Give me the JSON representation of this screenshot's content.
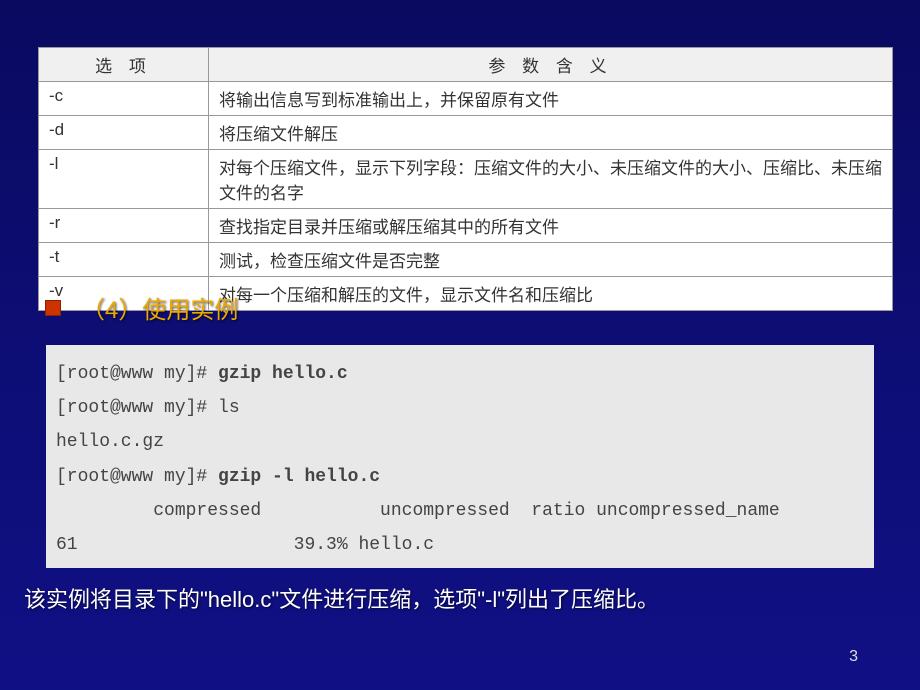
{
  "table": {
    "head_opt": "选    项",
    "head_desc": "参 数 含 义",
    "rows": [
      {
        "opt": "-c",
        "desc": "将输出信息写到标准输出上，并保留原有文件"
      },
      {
        "opt": "-d",
        "desc": "将压缩文件解压"
      },
      {
        "opt": "-l",
        "desc": "对每个压缩文件，显示下列字段：压缩文件的大小、未压缩文件的大小、压缩比、未压缩文件的名字"
      },
      {
        "opt": "-r",
        "desc": "查找指定目录并压缩或解压缩其中的所有文件"
      },
      {
        "opt": "-t",
        "desc": "测试，检查压缩文件是否完整"
      },
      {
        "opt": "-v",
        "desc": "对每一个压缩和解压的文件，显示文件名和压缩比"
      }
    ]
  },
  "section_title": "（4）使用实例",
  "code": {
    "l1a": "[root@www my]# ",
    "l1b": "gzip hello.c",
    "l2": "[root@www my]# ls",
    "l3": "hello.c.gz",
    "l4a": "[root@www my]# ",
    "l4b": "gzip -l hello.c",
    "l5": "         compressed           uncompressed  ratio uncompressed_name",
    "l6": "61                    39.3% hello.c"
  },
  "footer": "该实例将目录下的\"hello.c\"文件进行压缩，选项\"-l\"列出了压缩比。",
  "page": "3"
}
